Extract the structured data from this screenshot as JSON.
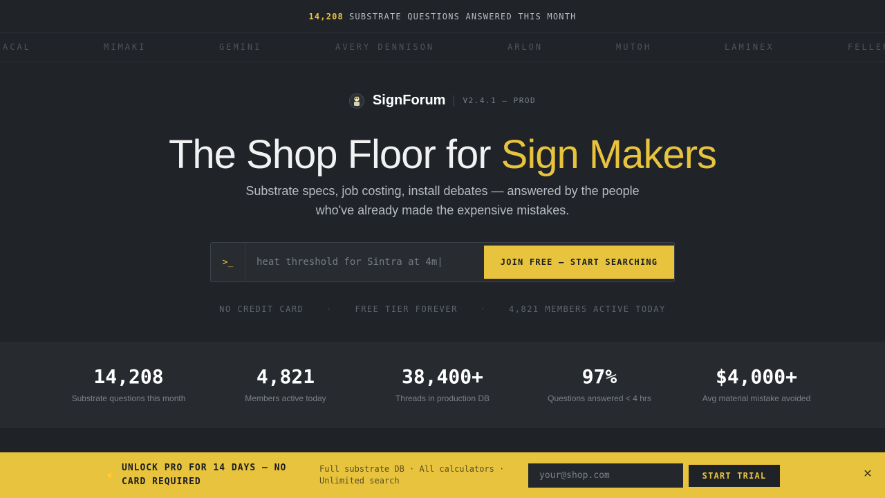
{
  "announcement": {
    "count": "14,208",
    "text": "SUBSTRATE QUESTIONS ANSWERED THIS MONTH"
  },
  "ticker": [
    "ACAL",
    "MIMAKI",
    "GEMINI",
    "AVERY DENNISON",
    "ARLON",
    "MUTOH",
    "LAMINEX",
    "FELLER"
  ],
  "brand": {
    "name": "SignForum",
    "version": "V2.4.1 — PROD",
    "logo_icon": "sign-maker-logo-icon"
  },
  "hero": {
    "headline_main": "The Shop Floor for ",
    "headline_accent": "Sign Makers",
    "subhead_line1": "Substrate specs, job costing, install debates — answered by the people",
    "subhead_line2": "who've already made the expensive mistakes."
  },
  "search": {
    "prompt": ">_",
    "placeholder": "heat threshold for Sintra at 4m|",
    "cta_label": "JOIN FREE — START SEARCHING"
  },
  "trust": [
    "NO CREDIT CARD",
    "FREE TIER FOREVER",
    "4,821 MEMBERS ACTIVE TODAY"
  ],
  "trust_separator": "·",
  "stats": [
    {
      "value": "14,208",
      "label": "Substrate questions this month"
    },
    {
      "value": "4,821",
      "label": "Members active today"
    },
    {
      "value": "38,400+",
      "label": "Threads in production DB"
    },
    {
      "value": "97%",
      "label": "Questions answered < 4 hrs"
    },
    {
      "value": "$4,000+",
      "label": "Avg material mistake avoided"
    }
  ],
  "promo": {
    "bolt_icon": "lightning-icon",
    "title": "UNLOCK PRO FOR 14 DAYS — NO CARD REQUIRED",
    "features": "Full substrate DB · All calculators · Unlimited search",
    "email_placeholder": "your@shop.com",
    "button_label": "START TRIAL",
    "close_icon": "close-icon"
  },
  "colors": {
    "accent": "#e8c33d",
    "background": "#1f2328"
  }
}
